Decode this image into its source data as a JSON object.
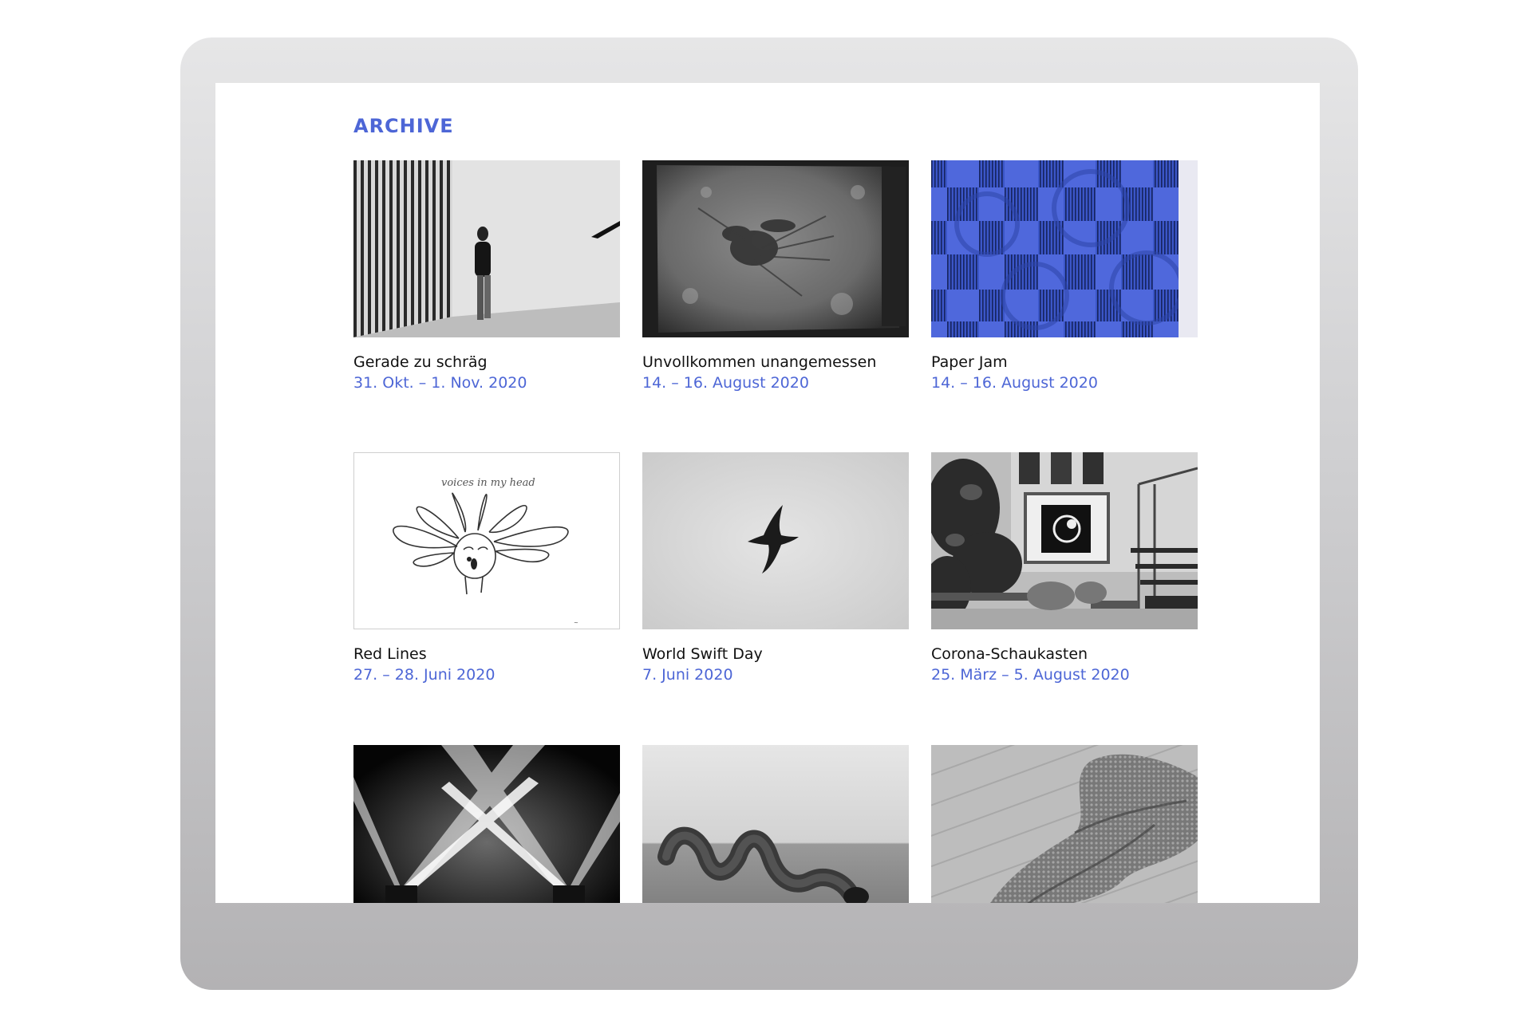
{
  "page": {
    "heading": "ARCHIVE",
    "accent_color": "#4d66d6"
  },
  "archive": {
    "items": [
      {
        "title": "Gerade zu schräg",
        "date": "31. Okt. – 1. Nov. 2020",
        "image": "gallery-stripes-person-photo"
      },
      {
        "title": "Unvollkommen unangemessen",
        "date": "14. – 16. August 2020",
        "image": "textured-print-photo"
      },
      {
        "title": "Paper Jam",
        "date": "14. – 16. August 2020",
        "image": "blue-checker-pattern"
      },
      {
        "title": "Red Lines",
        "date": "27. – 28. Juni 2020",
        "image": "line-drawing-head",
        "image_text": "voices in my head"
      },
      {
        "title": "World Swift Day",
        "date": "7. Juni 2020",
        "image": "swift-bird-photo"
      },
      {
        "title": "Corona-Schaukasten",
        "date": "25. März – 5. August 2020",
        "image": "courtyard-showcase-photo"
      },
      {
        "title": "",
        "date": "",
        "image": "light-beams-photo"
      },
      {
        "title": "",
        "date": "",
        "image": "tube-sculpture-photo"
      },
      {
        "title": "",
        "date": "",
        "image": "mesh-fabric-floor-photo"
      }
    ]
  }
}
